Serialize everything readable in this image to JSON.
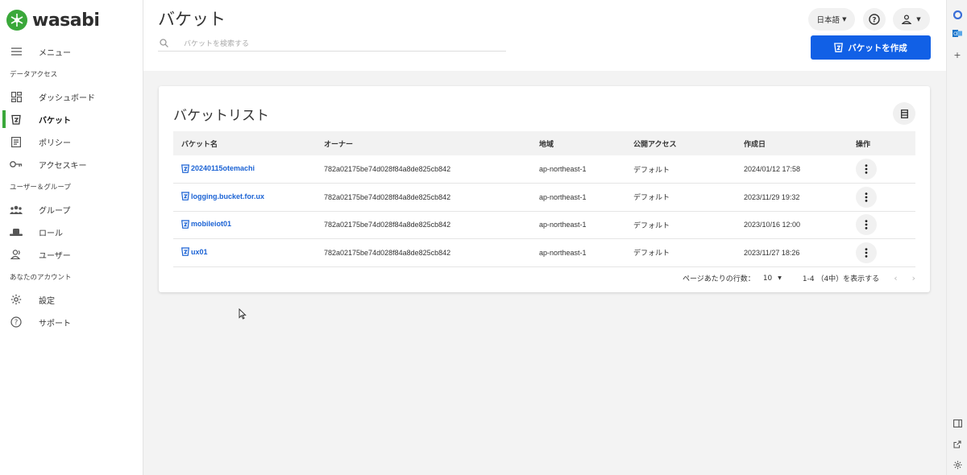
{
  "brand": {
    "name": "wasabi",
    "color": "#3aa83a"
  },
  "sidebar": {
    "menu_label": "メニュー",
    "sections": [
      {
        "title": "データアクセス",
        "items": [
          {
            "label": "ダッシュボード",
            "icon": "dashboard-icon",
            "active": false
          },
          {
            "label": "バケット",
            "icon": "bucket-icon",
            "active": true
          },
          {
            "label": "ポリシー",
            "icon": "policy-icon",
            "active": false
          },
          {
            "label": "アクセスキー",
            "icon": "key-icon",
            "active": false
          }
        ]
      },
      {
        "title": "ユーザー＆グループ",
        "items": [
          {
            "label": "グループ",
            "icon": "group-icon",
            "active": false
          },
          {
            "label": "ロール",
            "icon": "role-icon",
            "active": false
          },
          {
            "label": "ユーザー",
            "icon": "user-icon",
            "active": false
          }
        ]
      },
      {
        "title": "あなたのアカウント",
        "items": [
          {
            "label": "設定",
            "icon": "gear-icon",
            "active": false
          },
          {
            "label": "サポート",
            "icon": "help-icon",
            "active": false
          }
        ]
      }
    ]
  },
  "header": {
    "title": "バケット",
    "search_placeholder": "バケットを検索する",
    "language": "日本語",
    "create_button": "バケットを作成",
    "accent": "#1160e6"
  },
  "bucket_list": {
    "title": "バケットリスト",
    "columns": [
      "バケット名",
      "オーナー",
      "地域",
      "公開アクセス",
      "作成日",
      "操作"
    ],
    "rows": [
      {
        "name": "20240115otemachi",
        "owner": "782a02175be74d028f84a8de825cb842",
        "region": "ap-northeast-1",
        "access": "デフォルト",
        "created": "2024/01/12 17:58"
      },
      {
        "name": "logging.bucket.for.ux",
        "owner": "782a02175be74d028f84a8de825cb842",
        "region": "ap-northeast-1",
        "access": "デフォルト",
        "created": "2023/11/29 19:32"
      },
      {
        "name": "mobileiot01",
        "owner": "782a02175be74d028f84a8de825cb842",
        "region": "ap-northeast-1",
        "access": "デフォルト",
        "created": "2023/10/16 12:00"
      },
      {
        "name": "ux01",
        "owner": "782a02175be74d028f84a8de825cb842",
        "region": "ap-northeast-1",
        "access": "デフォルト",
        "created": "2023/11/27 18:26"
      }
    ],
    "pager": {
      "rows_per_page_label": "ページあたりの行数：",
      "rows_per_page": "10",
      "range_text": "1-4 （4中）を表示する"
    }
  }
}
